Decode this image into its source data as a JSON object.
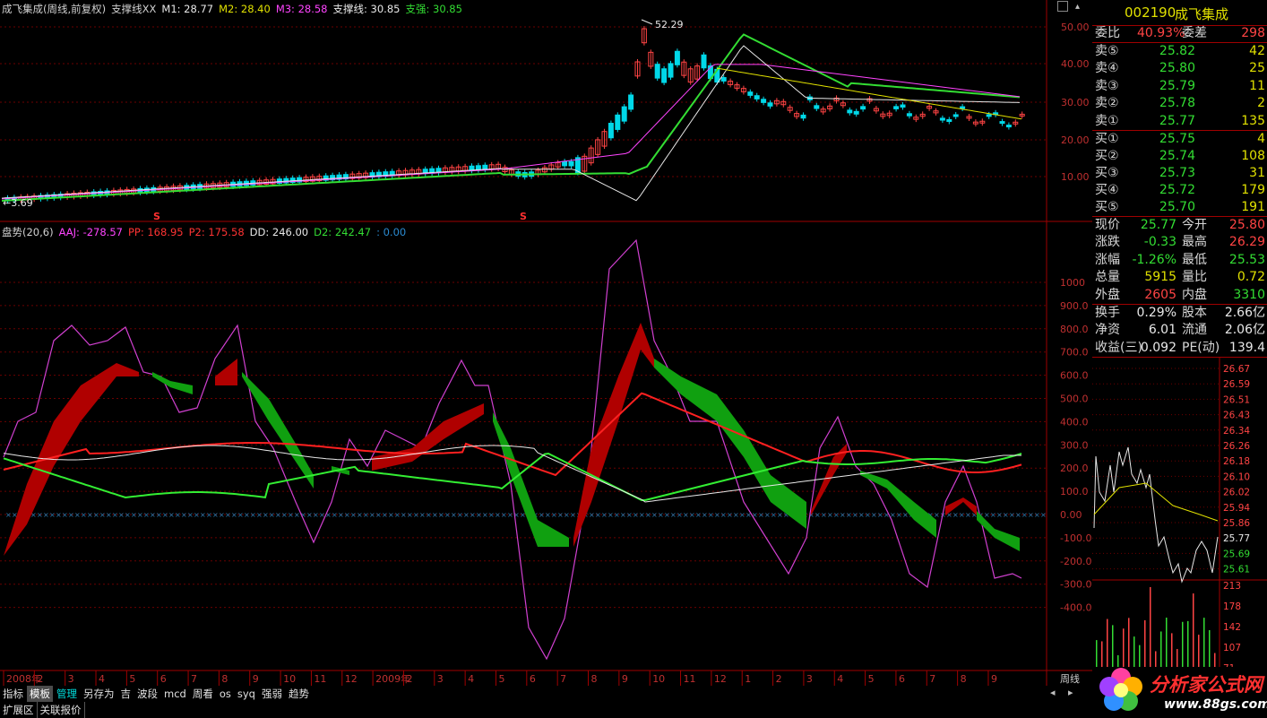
{
  "price_panel": {
    "title_items": [
      {
        "text": "成飞集成(周线,前复权)",
        "color": "#d0d0d0"
      },
      {
        "text": "支撑线XX",
        "color": "#d0d0d0"
      },
      {
        "text": "M1: 28.77",
        "color": "#e8e8e8"
      },
      {
        "text": "M2: 28.40",
        "color": "#e0e000"
      },
      {
        "text": "M3: 28.58",
        "color": "#ff44ff"
      },
      {
        "text": "支撑线: 30.85",
        "color": "#e8e8e8"
      },
      {
        "text": "支强: 30.85",
        "color": "#33dd33"
      }
    ],
    "high_label": "52.29",
    "low_label": "3.69",
    "low_arrow": "←",
    "signal_marks": [
      "S",
      "S"
    ],
    "y_ticks": [
      "50.00",
      "40.00",
      "30.00",
      "20.00",
      "10.00"
    ]
  },
  "indicator_panel": {
    "title_items": [
      {
        "text": "盘势(20,6)",
        "color": "#d0d0d0"
      },
      {
        "text": "AAJ: -278.57",
        "color": "#ff44ff"
      },
      {
        "text": "PP: 168.95",
        "color": "#ff3333"
      },
      {
        "text": "P2: 175.58",
        "color": "#ff3333"
      },
      {
        "text": "DD: 246.00",
        "color": "#e8e8e8"
      },
      {
        "text": "D2: 242.47",
        "color": "#33dd33"
      },
      {
        "text": ": 0.00",
        "color": "#2a8ad0"
      }
    ],
    "y_ticks": [
      "1000",
      "900.0",
      "800.0",
      "700.0",
      "600.0",
      "500.0",
      "400.0",
      "300.0",
      "200.0",
      "100.0",
      "0.00",
      "-100.0",
      "-200.0",
      "-300.0",
      "-400.0"
    ]
  },
  "time_axis": {
    "labels": [
      "2008年",
      "2",
      "3",
      "4",
      "5",
      "6",
      "7",
      "8",
      "9",
      "10",
      "11",
      "12",
      "2009年",
      "2",
      "3",
      "4",
      "5",
      "6",
      "7",
      "8",
      "9",
      "10",
      "11",
      "12",
      "1",
      "2",
      "3",
      "4",
      "5",
      "6",
      "7",
      "8",
      "9"
    ],
    "period": "周线"
  },
  "quote": {
    "code": "002190",
    "name": "成飞集成",
    "weibi_label": "委比",
    "weibi": "40.93%",
    "weicha_label": "委差",
    "weicha": "298",
    "asks": [
      {
        "label": "卖⑤",
        "price": "25.82",
        "vol": "42"
      },
      {
        "label": "卖④",
        "price": "25.80",
        "vol": "25"
      },
      {
        "label": "卖③",
        "price": "25.79",
        "vol": "11"
      },
      {
        "label": "卖②",
        "price": "25.78",
        "vol": "2"
      },
      {
        "label": "卖①",
        "price": "25.77",
        "vol": "135"
      }
    ],
    "bids": [
      {
        "label": "买①",
        "price": "25.75",
        "vol": "4"
      },
      {
        "label": "买②",
        "price": "25.74",
        "vol": "108"
      },
      {
        "label": "买③",
        "price": "25.73",
        "vol": "31"
      },
      {
        "label": "买④",
        "price": "25.72",
        "vol": "179"
      },
      {
        "label": "买⑤",
        "price": "25.70",
        "vol": "191"
      }
    ],
    "stats": [
      {
        "l1": "现价",
        "v1": "25.77",
        "c1": "dn",
        "l2": "今开",
        "v2": "25.80",
        "c2": "up"
      },
      {
        "l1": "涨跌",
        "v1": "-0.33",
        "c1": "dn",
        "l2": "最高",
        "v2": "26.29",
        "c2": "up"
      },
      {
        "l1": "涨幅",
        "v1": "-1.26%",
        "c1": "dn",
        "l2": "最低",
        "v2": "25.53",
        "c2": "dn"
      },
      {
        "l1": "总量",
        "v1": "5915",
        "c1": "yl",
        "l2": "量比",
        "v2": "0.72",
        "c2": "yl"
      },
      {
        "l1": "外盘",
        "v1": "2605",
        "c1": "up",
        "l2": "内盘",
        "v2": "3310",
        "c2": "dn"
      }
    ],
    "stats2": [
      {
        "l1": "换手",
        "v1": "0.29%",
        "l2": "股本",
        "v2": "2.66亿"
      },
      {
        "l1": "净资",
        "v1": "6.01",
        "l2": "流通",
        "v2": "2.06亿"
      },
      {
        "l1": "收益(三)",
        "v1": "0.092",
        "l2": "PE(动)",
        "v2": "139.4"
      }
    ],
    "intraday_ticks": [
      "26.67",
      "26.59",
      "26.51",
      "26.43",
      "26.34",
      "26.26",
      "26.18",
      "26.10",
      "26.02",
      "25.94",
      "25.86",
      "25.77",
      "25.69",
      "25.61"
    ],
    "volume_ticks": [
      "213",
      "178",
      "142",
      "107",
      "71"
    ]
  },
  "toolbar": [
    "指标",
    "模板",
    "管理",
    "另存为",
    "吉",
    "波段",
    "mcd",
    "周看",
    "os",
    "syq",
    "强弱",
    "趋势"
  ],
  "toolbar_selected": 1,
  "bottom_tabs": [
    "扩展区",
    "关联报价"
  ],
  "logo": {
    "text": "分析家公式网",
    "url": "www.88gs.com"
  },
  "colors": {
    "up": "#ff4444",
    "down": "#33dd33",
    "cyan": "#00d8e8",
    "grid": "#8b0000",
    "magenta": "#e040e0"
  }
}
